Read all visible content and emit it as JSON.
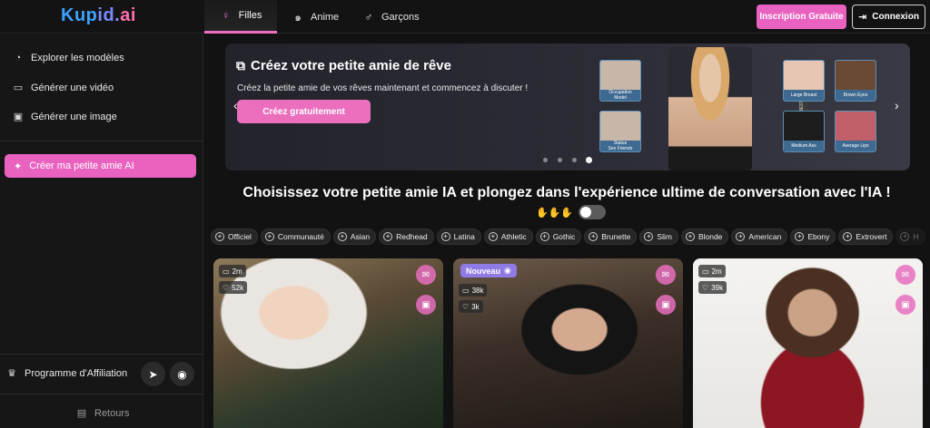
{
  "app": {
    "logo_part1": "Kup",
    "logo_part2": "id.",
    "logo_part3": "ai"
  },
  "nav": {
    "tabs": [
      {
        "label": "Filles",
        "icon": "female-icon",
        "active": true
      },
      {
        "label": "Anime",
        "icon": "spiral-icon",
        "active": false
      },
      {
        "label": "Garçons",
        "icon": "male-icon",
        "active": false
      }
    ],
    "signup_label": "Inscription Gratuite",
    "login_label": "Connexion"
  },
  "sidebar": {
    "items": [
      {
        "label": "Explorer les modèles",
        "icon": "compass-icon"
      },
      {
        "label": "Générer une vidéo",
        "icon": "video-icon"
      },
      {
        "label": "Générer une image",
        "icon": "image-icon"
      }
    ],
    "cta_label": "Créer ma petite amie AI",
    "affiliate_label": "Programme d'Affiliation",
    "feedback_label": "Retours"
  },
  "banner": {
    "title": "Créez votre petite amie de rêve",
    "subtitle": "Créez la petite amie de vos rêves maintenant et commencez à discuter !",
    "button_label": "Créez gratuitement",
    "vertical_label": "CHOOSE THE BEST PROPERTIES",
    "tags": [
      {
        "line1": "Occupation",
        "line2": "Model"
      },
      {
        "line1": "Status",
        "line2": "Sex Friends"
      },
      {
        "line1": "Large Breast",
        "line2": ""
      },
      {
        "line1": "Brown Eyes",
        "line2": ""
      },
      {
        "line1": "Medium Ass",
        "line2": ""
      },
      {
        "line1": "Average Lips",
        "line2": ""
      }
    ],
    "dots": 4,
    "active_dot": 4
  },
  "headline": "Choisissez votre petite amie IA et plongez dans l'expérience ultime de conversation avec l'IA !",
  "filters": [
    "Officiel",
    "Communauté",
    "Asian",
    "Redhead",
    "Latina",
    "Athletic",
    "Gothic",
    "Brunette",
    "Slim",
    "Blonde",
    "American",
    "Ebony",
    "Extrovert",
    "H"
  ],
  "cards": [
    {
      "badge": "",
      "stat1": "2m",
      "stat2": "52k"
    },
    {
      "badge": "Nouveau",
      "stat1": "38k",
      "stat2": "3k"
    },
    {
      "badge": "",
      "stat1": "2m",
      "stat2": "39k"
    }
  ],
  "colors": {
    "accent": "#e962c0",
    "background": "#121212",
    "sidebar": "#161616"
  }
}
